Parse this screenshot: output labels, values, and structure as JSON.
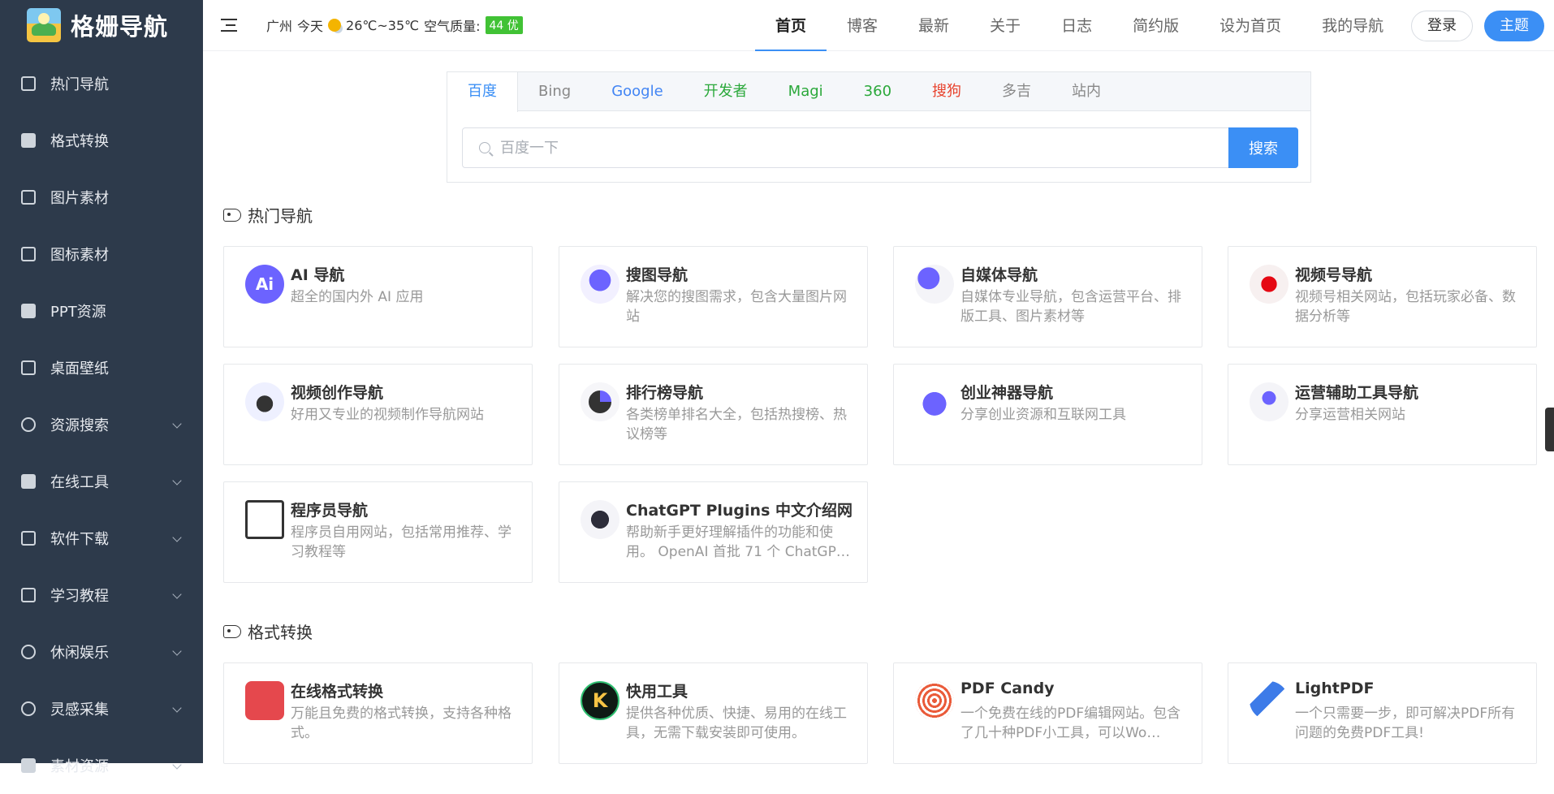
{
  "brand": {
    "name": "格姗导航"
  },
  "sidebar": {
    "items": [
      {
        "label": "热门导航",
        "icon": "thumbs-up-icon",
        "expandable": false
      },
      {
        "label": "格式转换",
        "icon": "bag-icon",
        "expandable": false
      },
      {
        "label": "图片素材",
        "icon": "images-icon",
        "expandable": false
      },
      {
        "label": "图标素材",
        "icon": "puzzle-icon",
        "expandable": false
      },
      {
        "label": "PPT资源",
        "icon": "shirt-icon",
        "expandable": false
      },
      {
        "label": "桌面壁纸",
        "icon": "monitor-icon",
        "expandable": false
      },
      {
        "label": "资源搜索",
        "icon": "search-icon",
        "expandable": true
      },
      {
        "label": "在线工具",
        "icon": "tools-icon",
        "expandable": true
      },
      {
        "label": "软件下载",
        "icon": "window-icon",
        "expandable": true
      },
      {
        "label": "学习教程",
        "icon": "graduation-cap-icon",
        "expandable": true
      },
      {
        "label": "休闲娱乐",
        "icon": "music-note-icon",
        "expandable": true
      },
      {
        "label": "灵感采集",
        "icon": "lightbulb-icon",
        "expandable": true
      },
      {
        "label": "素材资源",
        "icon": "globe-icon",
        "expandable": true
      }
    ]
  },
  "header": {
    "weather": {
      "city": "广州",
      "day": "今天",
      "temp": "26℃~35℃",
      "aqi_label": "空气质量:",
      "aqi_value": "44 优",
      "aqi_color": "#41c235"
    },
    "nav": [
      "首页",
      "博客",
      "最新",
      "关于",
      "日志",
      "简约版",
      "设为首页",
      "我的导航"
    ],
    "active_nav": "首页",
    "login_label": "登录",
    "theme_label": "主题",
    "accent_color": "#3b8ff5"
  },
  "search": {
    "tabs": [
      {
        "label": "百度",
        "color": "#3b8ff5"
      },
      {
        "label": "Bing",
        "color": "#888888"
      },
      {
        "label": "Google",
        "color": "#4285f4"
      },
      {
        "label": "开发者",
        "color": "#2aa83a"
      },
      {
        "label": "Magi",
        "color": "#2aa83a"
      },
      {
        "label": "360",
        "color": "#2aa83a"
      },
      {
        "label": "搜狗",
        "color": "#e8432e"
      },
      {
        "label": "多吉",
        "color": "#888888"
      },
      {
        "label": "站内",
        "color": "#888888"
      }
    ],
    "active_tab": "百度",
    "placeholder": "百度一下",
    "button_label": "搜索"
  },
  "sections": [
    {
      "title": "热门导航",
      "cards": [
        {
          "title": "AI 导航",
          "desc": "超全的国内外 AI 应用",
          "icon": "ai-badge-icon"
        },
        {
          "title": "搜图导航",
          "desc": "解决您的搜图需求，包含大量图片网站",
          "icon": "balloon-illustration-icon"
        },
        {
          "title": "自媒体导航",
          "desc": "自媒体专业导航，包含运营平台、排版工具、图片素材等",
          "icon": "media-person-icon"
        },
        {
          "title": "视频号导航",
          "desc": "视频号相关网站，包括玩家必备、数据分析等",
          "icon": "netflix-illustration-icon"
        },
        {
          "title": "视频创作导航",
          "desc": "好用又专业的视频制作导航网站",
          "icon": "video-stack-icon"
        },
        {
          "title": "排行榜导航",
          "desc": "各类榜单排名大全，包括热搜榜、热议榜等",
          "icon": "pie-chart-person-icon"
        },
        {
          "title": "创业神器导航",
          "desc": "分享创业资源和互联网工具",
          "icon": "heart-icon"
        },
        {
          "title": "运营辅助工具导航",
          "desc": "分享运营相关网站",
          "icon": "bitcoin-people-icon"
        },
        {
          "title": "程序员导航",
          "desc": "程序员自用网站，包括常用推荐、学习教程等",
          "icon": "presentation-icon"
        },
        {
          "title": "ChatGPT Plugins 中文介绍网",
          "desc": "帮助新手更好理解插件的功能和使用。 OpenAI 首批 71 个 ChatGP…",
          "icon": "robot-bird-icon"
        }
      ]
    },
    {
      "title": "格式转换",
      "cards": [
        {
          "title": "在线格式转换",
          "desc": "万能且免费的格式转换，支持各种格式。",
          "icon": "cube-logo-icon"
        },
        {
          "title": "快用工具",
          "desc": "提供各种优质、快捷、易用的在线工具，无需下载安装即可使用。",
          "icon": "k-logo-icon"
        },
        {
          "title": "PDF Candy",
          "desc": "一个免费在线的PDF编辑网站。包含了几十种PDF小工具，可以Wo…",
          "icon": "spiral-icon"
        },
        {
          "title": "LightPDF",
          "desc": "一个只需要一步，即可解决PDF所有问题的免费PDF工具!",
          "icon": "feather-icon"
        }
      ]
    }
  ]
}
